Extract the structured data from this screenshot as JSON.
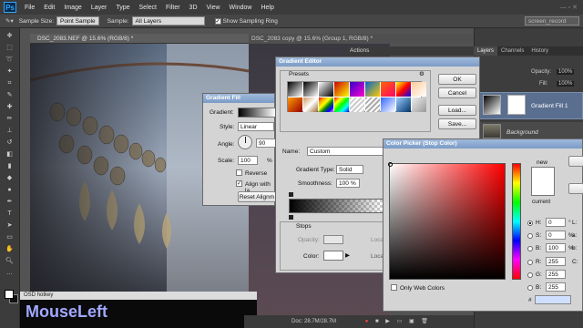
{
  "app": {
    "logo": "Ps"
  },
  "menu": [
    "File",
    "Edit",
    "Image",
    "Layer",
    "Type",
    "Select",
    "Filter",
    "3D",
    "View",
    "Window",
    "Help"
  ],
  "options": {
    "sample_size_label": "Sample Size:",
    "sample_size_value": "Point Sample",
    "sample_label": "Sample:",
    "sample_value": "All Layers",
    "show_ring_label": "Show Sampling Ring",
    "workspace": "screen_record"
  },
  "documents": {
    "doc1_title": "DSC_2083.NEF @ 15.6% (RGB/8) *",
    "doc2_title": "DSC_2083 copy @ 15.6% (Group 1, RGB/8) *"
  },
  "panels": {
    "actions_title": "Actions",
    "tabs": [
      "Layers",
      "Channels",
      "History"
    ],
    "opacity_label": "Opacity:",
    "opacity_value": "100%",
    "fill_label": "Fill:",
    "fill_value": "100%",
    "layer1_name": "Gradient Fill 1",
    "layer2_name": "Background"
  },
  "gradient_fill": {
    "title": "Gradient Fill",
    "gradient_label": "Gradient:",
    "style_label": "Style:",
    "style_value": "Linear",
    "angle_label": "Angle:",
    "angle_value": "90",
    "scale_label": "Scale:",
    "scale_value": "100",
    "scale_unit": "%",
    "reverse_label": "Reverse",
    "align_label": "Align with la",
    "reset_label": "Reset Alignm"
  },
  "gradient_editor": {
    "title": "Gradient Editor",
    "presets_label": "Presets",
    "ok": "OK",
    "cancel": "Cancel",
    "load": "Load...",
    "save": "Save...",
    "name_label": "Name:",
    "name_value": "Custom",
    "type_label": "Gradient Type:",
    "type_value": "Solid",
    "smooth_label": "Smoothness:",
    "smooth_value": "100",
    "smooth_unit": "%",
    "stops_label": "Stops",
    "opacity_label": "Opacity:",
    "location_label": "Locati",
    "color_label": "Color:",
    "location2_label": "Locat"
  },
  "color_picker": {
    "title": "Color Picker (Stop Color)",
    "new_label": "new",
    "current_label": "current",
    "only_web": "Only Web Colors",
    "h_label": "H:",
    "h_value": "0",
    "h_unit": "°",
    "s_label": "S:",
    "s_value": "0",
    "s_unit": "%",
    "b_label": "B:",
    "b_value": "100",
    "b_unit": "%",
    "r_label": "R:",
    "r_value": "255",
    "g_label": "G:",
    "g_value": "255",
    "bb_label": "B:",
    "bb_value": "255",
    "hex_label": "#",
    "l_label": "L:",
    "a_label": "a:",
    "b2_label": "b:",
    "c_label": "C:"
  },
  "osd": {
    "title": "OSD hotkey",
    "text": "MouseLeft"
  },
  "status": {
    "doc": "Doc: 28.7M/28.7M"
  }
}
